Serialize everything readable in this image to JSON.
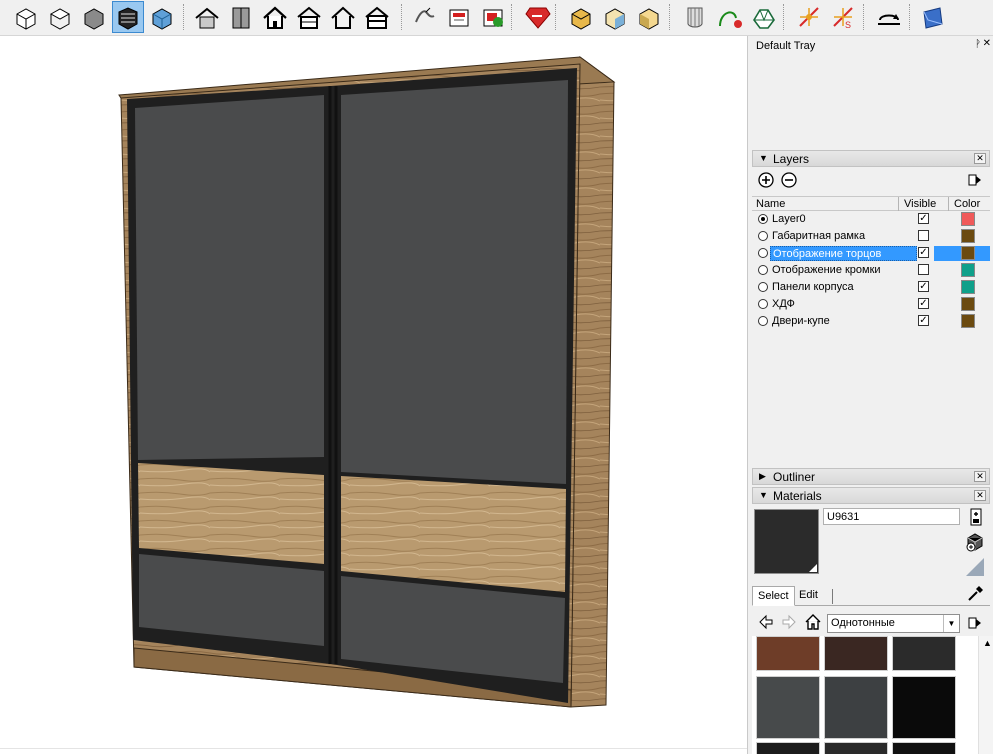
{
  "toolbar": {
    "tools": [
      {
        "icon": "iso-view-icon",
        "active": false
      },
      {
        "icon": "top-view-icon",
        "active": false
      },
      {
        "icon": "front-view-icon",
        "active": false
      },
      {
        "icon": "right-view-icon",
        "active": true
      },
      {
        "icon": "back-view-icon",
        "active": false
      },
      {
        "icon": "warehouse-icon",
        "active": false
      },
      {
        "icon": "get-models-icon",
        "active": false
      },
      {
        "icon": "home-icon",
        "active": false
      },
      {
        "icon": "share-model-icon",
        "active": false
      },
      {
        "icon": "home-outline-icon",
        "active": false
      },
      {
        "icon": "house-section-icon",
        "active": false
      },
      {
        "icon": "sandbox-icon",
        "active": false
      },
      {
        "icon": "photo-texture-icon",
        "active": false
      },
      {
        "icon": "add-location-icon",
        "active": false
      },
      {
        "icon": "ruby-console-icon",
        "active": false
      },
      {
        "icon": "solid-union-icon",
        "active": false
      },
      {
        "icon": "solid-subtract-icon",
        "active": false
      },
      {
        "icon": "solid-trim-icon",
        "active": false
      },
      {
        "icon": "styles-icon",
        "active": false
      },
      {
        "icon": "follow-me-icon",
        "active": false
      },
      {
        "icon": "soften-edges-icon",
        "active": false
      },
      {
        "icon": "section-plane-icon",
        "active": false
      },
      {
        "icon": "section-display-icon",
        "active": false
      },
      {
        "icon": "flip-icon",
        "active": false
      },
      {
        "icon": "blue-cube-icon",
        "active": false
      }
    ]
  },
  "tray": {
    "title": "Default Tray",
    "pin": "ᚹ",
    "close": "✕"
  },
  "layers": {
    "title": "Layers",
    "columns": {
      "name": "Name",
      "visible": "Visible",
      "color": "Color"
    },
    "rows": [
      {
        "name": "Layer0",
        "active": true,
        "visible": true,
        "color": "#f05a5a",
        "selected": false
      },
      {
        "name": "Габаритная рамка",
        "active": false,
        "visible": false,
        "color": "#6b4a10",
        "selected": false
      },
      {
        "name": "Отображение торцов",
        "active": false,
        "visible": true,
        "color": "#6b4a10",
        "selected": true
      },
      {
        "name": "Отображение кромки",
        "active": false,
        "visible": false,
        "color": "#0fa08a",
        "selected": false
      },
      {
        "name": "Панели корпуса",
        "active": false,
        "visible": true,
        "color": "#0fa08a",
        "selected": false
      },
      {
        "name": "ХДФ",
        "active": false,
        "visible": true,
        "color": "#6b4a10",
        "selected": false
      },
      {
        "name": "Двери-купе",
        "active": false,
        "visible": true,
        "color": "#6b4a10",
        "selected": false
      }
    ]
  },
  "outliner": {
    "title": "Outliner"
  },
  "materials": {
    "title": "Materials",
    "current_name": "U9631",
    "current_color": "#2b2b2b",
    "tabs": [
      "Select",
      "Edit"
    ],
    "library": "Однотонные",
    "swatches": [
      "#6e3d28",
      "#3a2722",
      "#2b2b2b",
      "#474a4b",
      "#3d4042",
      "#0a0a0a",
      "#1c1c1c",
      "#2a2a2a",
      "#111111"
    ]
  }
}
